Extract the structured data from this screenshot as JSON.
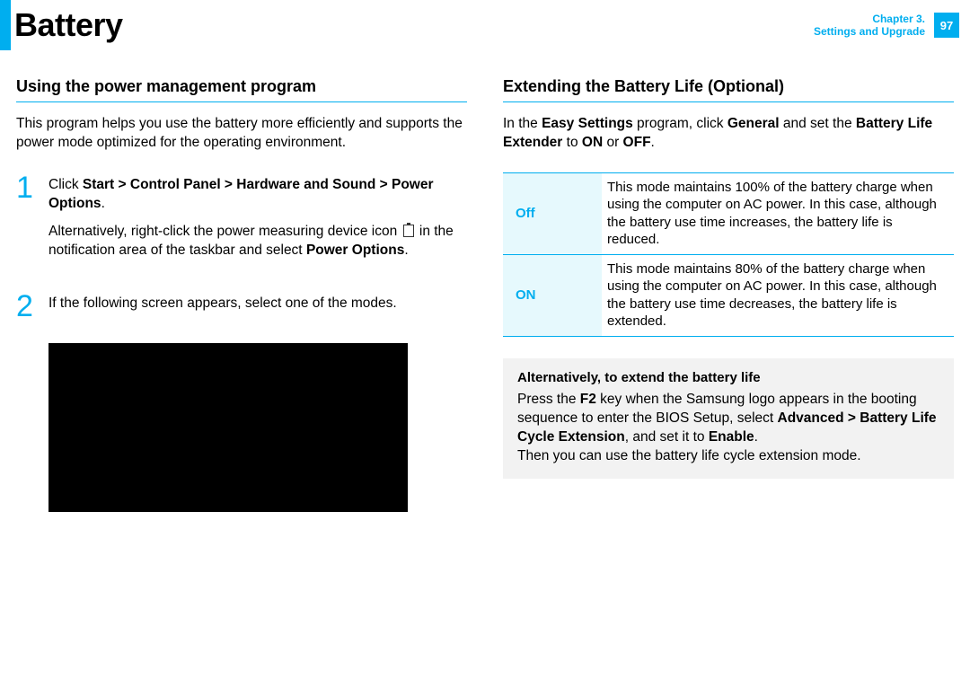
{
  "header": {
    "title": "Battery",
    "chapter_line1": "Chapter 3.",
    "chapter_line2": "Settings and Upgrade",
    "page": "97"
  },
  "left": {
    "heading": "Using the power management program",
    "intro": "This program helps you use the battery more efficiently and supports the power mode optimized for the operating environment.",
    "steps": {
      "s1_num": "1",
      "s1_a_pre": "Click ",
      "s1_a_bold": "Start > Control Panel > Hardware and Sound > Power Options",
      "s1_a_post": ".",
      "s1_b_pre": "Alternatively, right-click the power measuring device icon ",
      "s1_b_mid": " in the notification area of the taskbar and select ",
      "s1_b_bold": "Power Options",
      "s1_b_post": ".",
      "s2_num": "2",
      "s2_text": "If the following screen appears, select one of the modes."
    }
  },
  "right": {
    "heading": "Extending the Battery Life (Optional)",
    "intro_pre": "In the ",
    "intro_b1": "Easy Settings",
    "intro_mid1": " program, click ",
    "intro_b2": "General",
    "intro_mid2": " and set the ",
    "intro_b3": "Battery Life Extender",
    "intro_mid3": " to ",
    "intro_b4": "ON",
    "intro_mid4": " or ",
    "intro_b5": "OFF",
    "intro_post": ".",
    "table": {
      "off_label": "Off",
      "off_text": "This mode maintains 100% of the battery charge when using the computer on AC power. In this case, although the battery use time increases, the battery life is reduced.",
      "on_label": "ON",
      "on_text": "This mode maintains 80% of the battery charge when using the computer on AC power. In this case, although the battery use time decreases, the battery life is extended."
    },
    "note": {
      "title": "Alternatively, to extend the battery life",
      "l1_pre": "Press the ",
      "l1_b1": "F2",
      "l1_mid1": " key when the Samsung logo appears in the booting sequence to enter the BIOS Setup, select ",
      "l1_b2": "Advanced > Battery Life Cycle Extension",
      "l1_mid2": ", and set it to ",
      "l1_b3": "Enable",
      "l1_post": ".",
      "l2": "Then you can use the battery life cycle extension mode."
    }
  }
}
